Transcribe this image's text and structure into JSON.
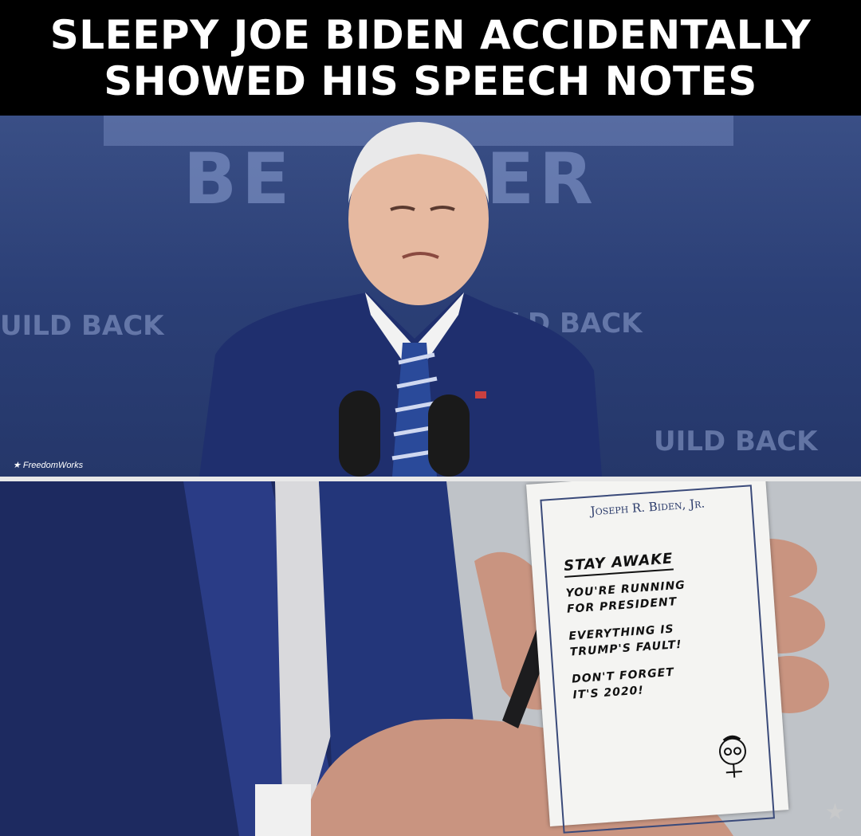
{
  "banner": {
    "line1": "SLEEPY JOE BIDEN ACCIDENTALLY",
    "line2": "SHOWED HIS SPEECH NOTES"
  },
  "top_photo": {
    "backdrop_text": "BUILD BACK BETTER",
    "watermark": "★ FreedomWorks"
  },
  "note_card": {
    "header": "Joseph R. Biden, Jr.",
    "title": "STAY AWAKE",
    "lines": [
      "YOU'RE RUNNING",
      "FOR PRESIDENT",
      "EVERYTHING IS",
      "TRUMP'S FAULT!",
      "DON'T FORGET",
      "IT'S 2020!"
    ]
  },
  "colors": {
    "banner_bg": "#000000",
    "banner_text": "#ffffff",
    "backdrop_blue": "#2b3f76",
    "suit_blue": "#1f2f6e"
  }
}
